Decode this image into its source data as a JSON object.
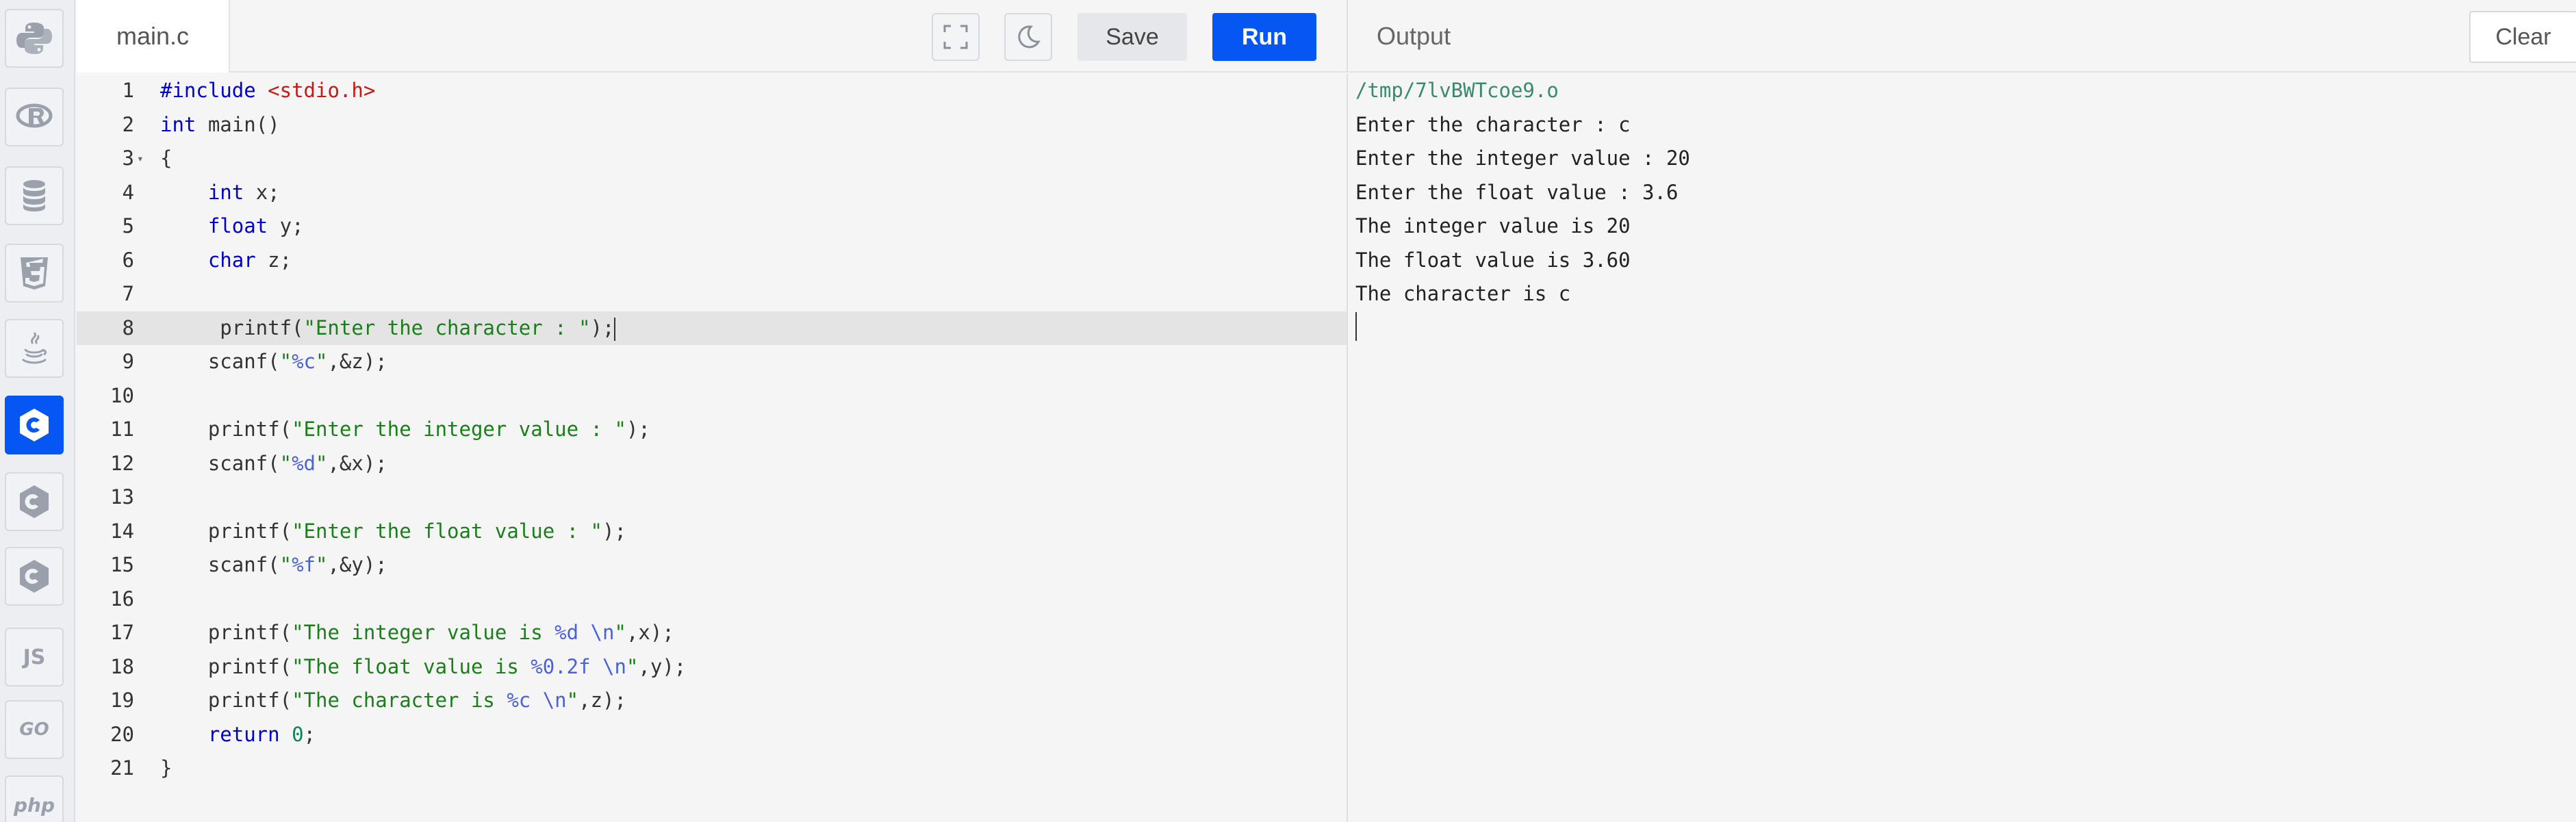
{
  "sidebar": {
    "languages": [
      {
        "name": "python-icon"
      },
      {
        "name": "r-icon"
      },
      {
        "name": "database-icon"
      },
      {
        "name": "html5-icon"
      },
      {
        "name": "java-icon"
      },
      {
        "name": "c-icon"
      },
      {
        "name": "cpp-icon"
      },
      {
        "name": "csharp-icon"
      },
      {
        "name": "javascript-icon",
        "label": "JS"
      },
      {
        "name": "go-icon",
        "label": "GO"
      },
      {
        "name": "php-icon",
        "label": "php"
      }
    ]
  },
  "editor": {
    "file_name": "main.c",
    "save_label": "Save",
    "run_label": "Run",
    "line_numbers": [
      "1",
      "2",
      "3",
      "4",
      "5",
      "6",
      "7",
      "8",
      "9",
      "10",
      "11",
      "12",
      "13",
      "14",
      "15",
      "16",
      "17",
      "18",
      "19",
      "20",
      "21"
    ]
  },
  "output": {
    "title": "Output",
    "clear_label": "Clear",
    "lines": [
      "/tmp/7lvBWTcoe9.o",
      "Enter the character : c",
      "Enter the integer value : 20",
      "Enter the float value : 3.6",
      "The integer value is 20",
      "The float value is 3.60",
      "The character is c"
    ]
  },
  "colors": {
    "accent": "#0556f3",
    "keyword": "#0000cc",
    "string": "#1a7f1a",
    "include": "#c41a16",
    "format_specifier": "#4a62d8"
  }
}
